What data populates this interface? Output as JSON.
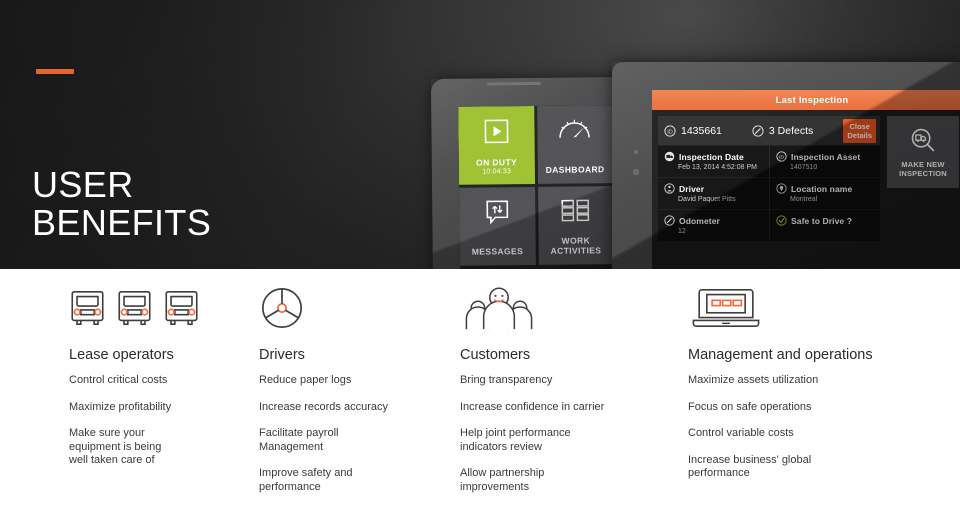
{
  "hero": {
    "title": "USER\nBENEFITS",
    "accent_color": "#e8652a",
    "background_color": "#2b2b2b"
  },
  "tablet_left": {
    "device_name": "tablet-device",
    "tiles": [
      {
        "label": "ON DUTY",
        "sub": "10:04:33",
        "icon": "play-icon",
        "color": "#9cc02c"
      },
      {
        "label": "DASHBOARD",
        "sub": "",
        "icon": "gauge-icon",
        "color": "#4e4e52"
      },
      {
        "label": "MESSAGES",
        "sub": "",
        "icon": "messages-icon",
        "color": "#4e4e52"
      },
      {
        "label": "WORK ACTIVITIES",
        "sub": "",
        "icon": "grid-icon",
        "color": "#4e4e52"
      }
    ]
  },
  "tablet_right": {
    "header_title": "Last Inspection",
    "header_color": "#ec6b38",
    "summary": {
      "inspection_id": "1435661",
      "id_icon": "id-badge-icon",
      "defects": "3 Defects",
      "defects_icon": "wrench-icon",
      "close_details_label": "Close\nDetails",
      "close_details_color": "#e8531f"
    },
    "fields": [
      {
        "icon": "calendar-truck-icon",
        "title": "Inspection Date",
        "value": "Feb 13, 2014 4:52:08 PM"
      },
      {
        "icon": "id-badge-icon",
        "title": "Inspection Asset",
        "value": "1407510"
      },
      {
        "icon": "person-icon",
        "title": "Driver",
        "value": "David Paquet Pitts"
      },
      {
        "icon": "location-pin-icon",
        "title": "Location name",
        "value": "Montreal"
      },
      {
        "icon": "odometer-icon",
        "title": "Odometer",
        "value": "12"
      },
      {
        "icon": "check-circle-icon",
        "title": "Safe to Drive ?",
        "value": ""
      }
    ],
    "make_new": {
      "icon": "truck-search-icon",
      "label": "MAKE NEW\nINSPECTION"
    }
  },
  "benefits": {
    "columns": [
      {
        "icon": "truck-front-icon",
        "icon_count": 3,
        "title": "Lease operators",
        "items": [
          "Control critical costs",
          "Maximize profitability",
          "Make sure your\nequipment is being\nwell taken care of"
        ]
      },
      {
        "icon": "steering-wheel-icon",
        "icon_count": 1,
        "title": "Drivers",
        "items": [
          "Reduce paper logs",
          "Increase records accuracy",
          "Facilitate payroll\nManagement",
          "Improve safety and\nperformance"
        ]
      },
      {
        "icon": "people-group-icon",
        "icon_count": 1,
        "title": "Customers",
        "items": [
          "Bring transparency",
          "Increase confidence in carrier",
          "Help joint performance\nindicators review",
          "Allow partnership\nimprovements"
        ]
      },
      {
        "icon": "laptop-icon",
        "icon_count": 1,
        "title": "Management and operations",
        "items": [
          "Maximize assets utilization",
          "Focus on safe operations",
          "Control variable costs",
          "Increase business' global\nperformance"
        ]
      }
    ]
  },
  "colors": {
    "accent_orange": "#e8652a",
    "tile_green": "#9cc02c",
    "icon_stroke": "#3f3f3f",
    "icon_accent": "#f26b3a"
  }
}
